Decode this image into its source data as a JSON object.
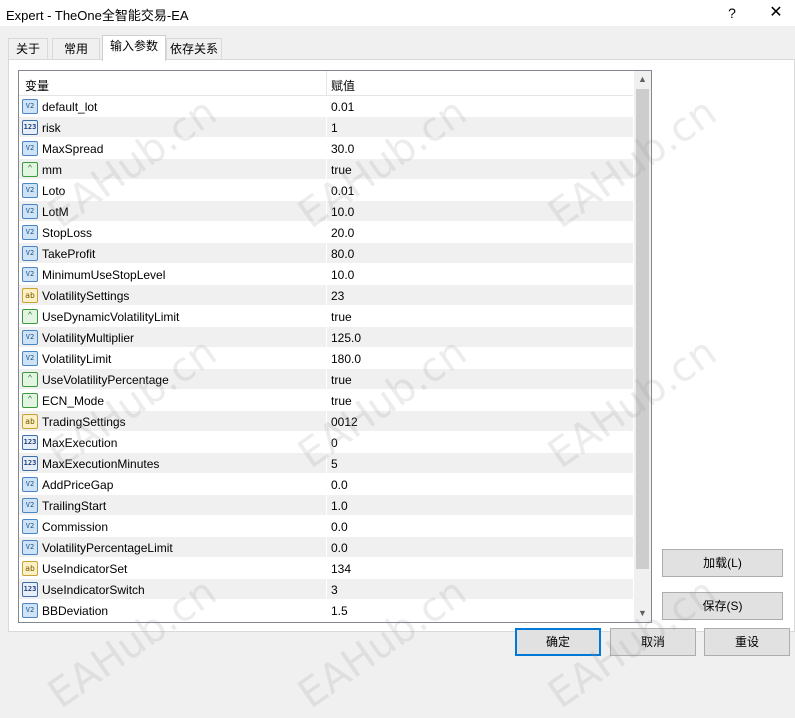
{
  "window": {
    "title": "Expert - TheOne全智能交易-EA",
    "help_label": "?",
    "close_label": "✕"
  },
  "tabs": [
    {
      "label": "关于"
    },
    {
      "label": "常用"
    },
    {
      "label": "输入参数"
    },
    {
      "label": "依存关系"
    }
  ],
  "active_tab": "输入参数",
  "grid": {
    "header_variable": "变量",
    "header_value": "赋值",
    "rows": [
      {
        "icon": "v2",
        "name": "default_lot",
        "value": "0.01"
      },
      {
        "icon": "123",
        "name": "risk",
        "value": "1"
      },
      {
        "icon": "v2",
        "name": "MaxSpread",
        "value": "30.0"
      },
      {
        "icon": "bool",
        "name": "mm",
        "value": "true"
      },
      {
        "icon": "v2",
        "name": "Loto",
        "value": "0.01"
      },
      {
        "icon": "v2",
        "name": "LotM",
        "value": "10.0"
      },
      {
        "icon": "v2",
        "name": "StopLoss",
        "value": "20.0"
      },
      {
        "icon": "v2",
        "name": "TakeProfit",
        "value": "80.0"
      },
      {
        "icon": "v2",
        "name": "MinimumUseStopLevel",
        "value": "10.0"
      },
      {
        "icon": "ab",
        "name": "VolatilitySettings",
        "value": "23"
      },
      {
        "icon": "bool",
        "name": "UseDynamicVolatilityLimit",
        "value": "true"
      },
      {
        "icon": "v2",
        "name": "VolatilityMultiplier",
        "value": "125.0"
      },
      {
        "icon": "v2",
        "name": "VolatilityLimit",
        "value": "180.0"
      },
      {
        "icon": "bool",
        "name": "UseVolatilityPercentage",
        "value": "true"
      },
      {
        "icon": "bool",
        "name": "ECN_Mode",
        "value": "true"
      },
      {
        "icon": "ab",
        "name": "TradingSettings",
        "value": "0012"
      },
      {
        "icon": "123",
        "name": "MaxExecution",
        "value": "0"
      },
      {
        "icon": "123",
        "name": "MaxExecutionMinutes",
        "value": "5"
      },
      {
        "icon": "v2",
        "name": "AddPriceGap",
        "value": "0.0"
      },
      {
        "icon": "v2",
        "name": "TrailingStart",
        "value": "1.0"
      },
      {
        "icon": "v2",
        "name": "Commission",
        "value": "0.0"
      },
      {
        "icon": "v2",
        "name": "VolatilityPercentageLimit",
        "value": "0.0"
      },
      {
        "icon": "ab",
        "name": "UseIndicatorSet",
        "value": "134"
      },
      {
        "icon": "123",
        "name": "UseIndicatorSwitch",
        "value": "3"
      },
      {
        "icon": "v2",
        "name": "BBDeviation",
        "value": "1.5"
      }
    ]
  },
  "scrollbar": {
    "up_label": "▲",
    "down_label": "▼"
  },
  "buttons": {
    "load_label": "加载(L)",
    "save_label": "保存(S)",
    "ok_label": "确定",
    "cancel_label": "取消",
    "reset_label": "重设"
  },
  "watermark_text": "EAHub.cn",
  "icon_labels": {
    "v2": "V2",
    "123": "123",
    "bool": "⌃",
    "ab": "ab"
  }
}
